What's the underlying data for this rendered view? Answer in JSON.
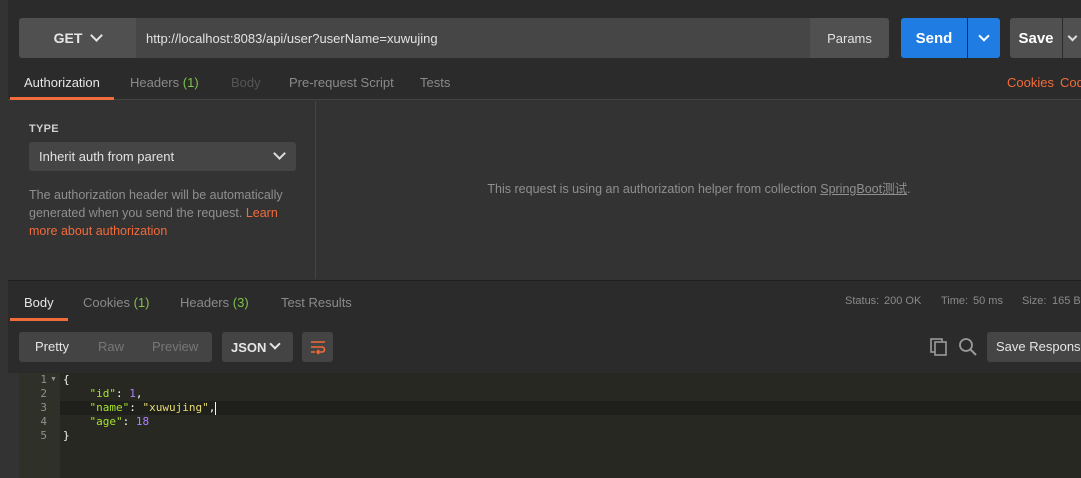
{
  "request": {
    "method": "GET",
    "url": "http://localhost:8083/api/user?userName=xuwujing",
    "params_label": "Params",
    "send_label": "Send",
    "save_label": "Save"
  },
  "request_tabs": {
    "authorization": "Authorization",
    "headers": "Headers",
    "headers_count": "(1)",
    "body": "Body",
    "prerequest": "Pre-request Script",
    "tests": "Tests",
    "cookies": "Cookies",
    "code": "Code"
  },
  "auth": {
    "type_label": "TYPE",
    "selected_type": "Inherit auth from parent",
    "description": "The authorization header will be automatically generated when you send the request. ",
    "learn_more": "Learn more about authorization",
    "helper_prefix": "This request is using an authorization helper from collection ",
    "collection_name": "SpringBoot测试",
    "helper_suffix": "."
  },
  "response_tabs": {
    "body": "Body",
    "cookies": "Cookies",
    "cookies_count": "(1)",
    "headers": "Headers",
    "headers_count": "(3)",
    "test_results": "Test Results"
  },
  "status": {
    "status_label": "Status:",
    "status_value": "200 OK",
    "time_label": "Time:",
    "time_value": "50 ms",
    "size_label": "Size:",
    "size_value": "165 B"
  },
  "response_toolbar": {
    "pretty": "Pretty",
    "raw": "Raw",
    "preview": "Preview",
    "format": "JSON",
    "save_response": "Save Response"
  },
  "code_lines": {
    "l1": "1",
    "l2": "2",
    "l3": "3",
    "l4": "4",
    "l5": "5",
    "open_brace": "{",
    "close_brace": "}",
    "id_key": "\"id\"",
    "id_value": "1",
    "name_key": "\"name\"",
    "name_value": "\"xuwujing\"",
    "age_key": "\"age\"",
    "age_value": "18"
  },
  "colors": {
    "accent": "#f26b3a",
    "send_blue": "#1f7ce3",
    "status_green": "#7fc24b"
  }
}
